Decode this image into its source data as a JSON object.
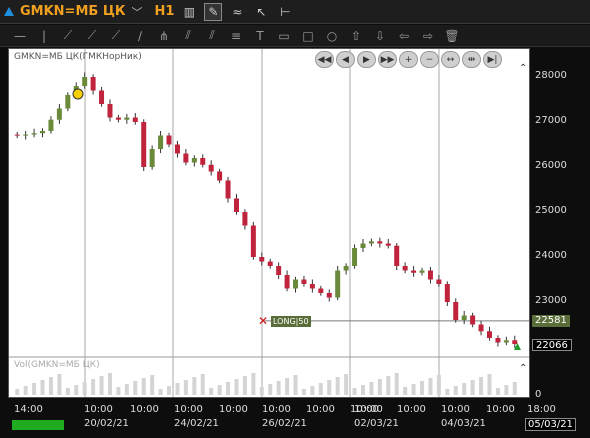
{
  "toolbar": {
    "symbol": "GMKN=МБ ЦК",
    "timeframe": "H1",
    "icons": [
      "candles-icon",
      "draw-icon",
      "chart-style-icon",
      "cursor-icon",
      "indicators-icon"
    ]
  },
  "drawtools": [
    "hline-icon",
    "vline-icon",
    "ray-icon",
    "segment-icon",
    "extended-line-icon",
    "trend-icon",
    "pitchfork-icon",
    "parallel-icon",
    "fib-fan-icon",
    "fib-levels-icon",
    "text-icon",
    "note-icon",
    "rectangle-icon",
    "ellipse-icon",
    "arrow-up-icon",
    "arrow-down-icon",
    "arrow-left-icon",
    "arrow-right-icon",
    "trash-icon"
  ],
  "chart": {
    "legend": "GMKN=МБ ЦК(ГМКНорНик)",
    "volume_legend": "Vol(GMKN=МБ ЦК)",
    "long_label": "LONG|50",
    "last_date": "05/03/21",
    "price_tag_top": "22581",
    "price_tag_bottom": "22066",
    "colors": {
      "up": "#6a8a3a",
      "down": "#c0243c",
      "long_line": "#7a7a7a"
    }
  },
  "chart_data": {
    "type": "candlestick",
    "y_ticks": [
      "28000",
      "27000",
      "26000",
      "25000",
      "24000",
      "23000",
      "22000"
    ],
    "volume_tick": "0",
    "x_ticks": [
      {
        "top": "14:00",
        "bottom": ""
      },
      {
        "top": "10:00",
        "bottom": "20/02/21"
      },
      {
        "top": "10:00",
        "bottom": ""
      },
      {
        "top": "10:00",
        "bottom": "24/02/21"
      },
      {
        "top": "10:00",
        "bottom": ""
      },
      {
        "top": "10:00",
        "bottom": "26/02/21"
      },
      {
        "top": "10:00",
        "bottom": ""
      },
      {
        "top": "10:00",
        "bottom": ""
      },
      {
        "top": "10:00",
        "bottom": "02/03/21"
      },
      {
        "top": "10:00",
        "bottom": ""
      },
      {
        "top": "10:00",
        "bottom": "04/03/21"
      },
      {
        "top": "10:00",
        "bottom": ""
      },
      {
        "top": "18:00",
        "bottom": ""
      }
    ],
    "closes": [
      26700,
      26720,
      26750,
      26800,
      27050,
      27300,
      27600,
      27800,
      28000,
      27700,
      27400,
      27100,
      27050,
      27100,
      27000,
      26000,
      26400,
      26700,
      26500,
      26300,
      26100,
      26200,
      26050,
      25900,
      25700,
      25300,
      25000,
      24700,
      24000,
      23900,
      23800,
      23600,
      23300,
      23500,
      23400,
      23300,
      23200,
      23100,
      23700,
      23800,
      24200,
      24300,
      24350,
      24300,
      24250,
      23800,
      23700,
      23650,
      23700,
      23500,
      23400,
      23000,
      22600,
      22700,
      22500,
      22350,
      22200,
      22100,
      22150,
      22066
    ]
  }
}
